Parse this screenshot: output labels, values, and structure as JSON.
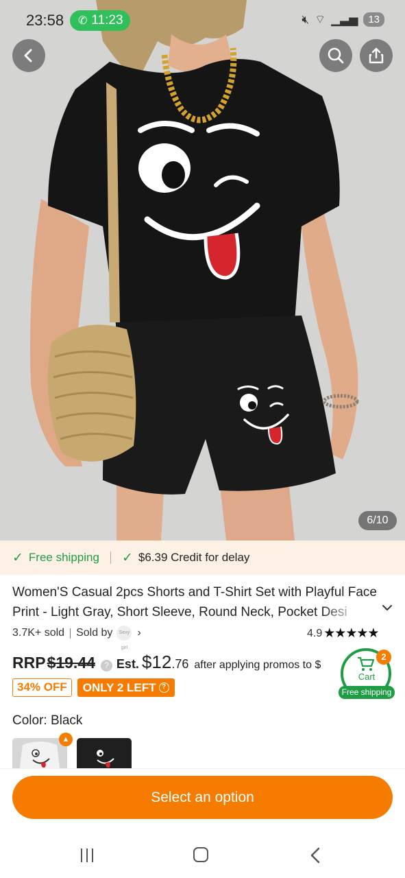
{
  "status_bar": {
    "time": "23:58",
    "call_time": "11:23",
    "battery": "13"
  },
  "gallery": {
    "counter": "6/10"
  },
  "shipping": {
    "free_shipping": "Free shipping",
    "credit": "$6.39 Credit for delay"
  },
  "product": {
    "title": "Women'S Casual 2pcs Shorts and T-Shirt Set with Playful Face Print - Light Gray, Short Sleeve, Round Neck, Pocket Desi",
    "sold": "3.7K+ sold",
    "sold_by": "Sold by",
    "seller_logo_text": "Sexy girl",
    "rating": "4.9",
    "stars": "★★★★★"
  },
  "price": {
    "rrp_label": "RRP",
    "rrp_value": "$19.44",
    "est_label": "Est.",
    "est_dollars": "$12",
    "est_cents": ".76",
    "after_text": "after applying promos to $"
  },
  "badges": {
    "discount": "34% OFF",
    "stock": "ONLY 2 LEFT"
  },
  "cart": {
    "count": "2",
    "label": "Cart",
    "shipping": "Free shipping"
  },
  "variant": {
    "color_label": "Color: Black"
  },
  "actions": {
    "select": "Select an option"
  },
  "colors": {
    "accent": "#f57c00",
    "green": "#1f9d45",
    "shipping_bg": "#fdf1e6"
  },
  "icons": {
    "back": "back-arrow-icon",
    "search": "search-icon",
    "share": "share-icon"
  }
}
